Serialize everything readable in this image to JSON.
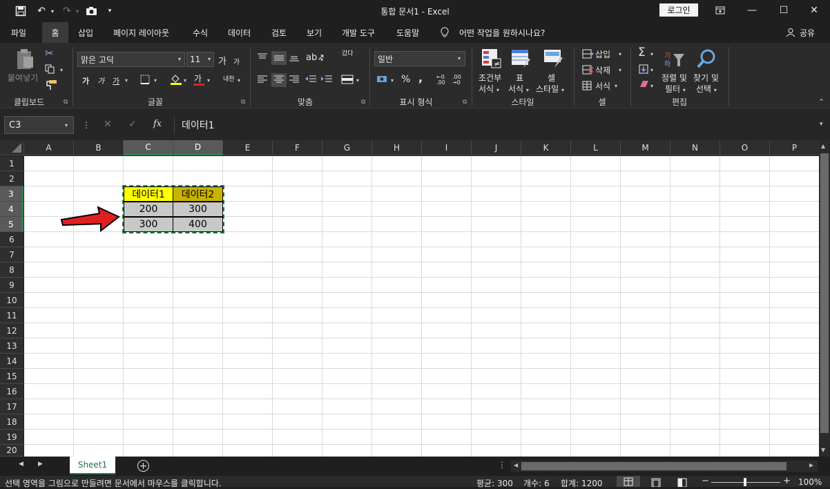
{
  "window": {
    "title": "통합 문서1  -  Excel",
    "login_label": "로그인"
  },
  "menu": {
    "items": [
      "파일",
      "홈",
      "삽입",
      "페이지 레이아웃",
      "수식",
      "데이터",
      "검토",
      "보기",
      "개발 도구",
      "도움말"
    ],
    "tell_me": "어떤 작업을 원하시나요?",
    "share": "공유"
  },
  "ribbon": {
    "clipboard": {
      "paste_label": "붙여넣기",
      "group": "클립보드"
    },
    "font": {
      "name": "맑은 고딕",
      "size": "11",
      "group": "글꼴",
      "grow": "가",
      "shrink": "가",
      "bold": "가",
      "italic": "가",
      "underline": "가",
      "color_letter": "가",
      "phonetic": "내천"
    },
    "alignment": {
      "group": "맞춤",
      "wrap": "갔다"
    },
    "number": {
      "format": "일반",
      "group": "표시 형식",
      "percent": "%",
      "comma": ","
    },
    "styles": {
      "group": "스타일",
      "conditional": [
        "조건부",
        "서식"
      ],
      "table": [
        "표",
        "서식"
      ],
      "cell": [
        "셀",
        "스타일"
      ]
    },
    "cells": {
      "group": "셀",
      "insert": "삽입",
      "delete": "삭제",
      "format": "서식"
    },
    "editing": {
      "group": "편집",
      "sort": [
        "정렬 및",
        "필터"
      ],
      "find": [
        "찾기 및",
        "선택"
      ]
    }
  },
  "formula_bar": {
    "name_box": "C3",
    "value": "데이터1"
  },
  "grid": {
    "columns": [
      "A",
      "B",
      "C",
      "D",
      "E",
      "F",
      "G",
      "H",
      "I",
      "J",
      "K",
      "L",
      "M",
      "N",
      "O",
      "P"
    ],
    "rows": [
      "1",
      "2",
      "3",
      "4",
      "5",
      "6",
      "7",
      "8",
      "9",
      "10",
      "11",
      "12",
      "13",
      "14",
      "15",
      "16",
      "17",
      "18",
      "19",
      "20"
    ],
    "cells": {
      "C3": "데이터1",
      "D3": "데이터2",
      "C4": "200",
      "D4": "300",
      "C5": "300",
      "D5": "400"
    },
    "header_colors": {
      "C3": "#ffff00",
      "D3": "#c9b300"
    },
    "data_fill": "#c8c8c8"
  },
  "tabs": {
    "sheet": "Sheet1"
  },
  "status": {
    "message": "선택 영역을 그림으로 만들려면 문서에서 마우스를 클릭합니다.",
    "average": "평균: 300",
    "count": "개수: 6",
    "sum": "합계: 1200",
    "zoom": "100%"
  }
}
